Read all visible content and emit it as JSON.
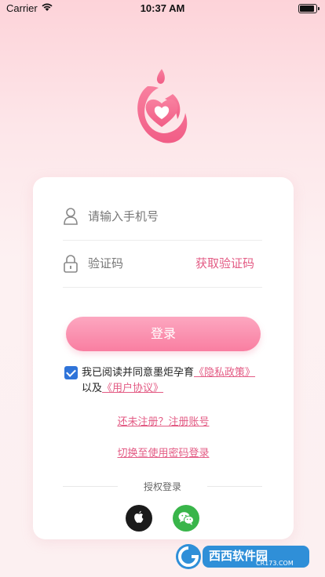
{
  "status_bar": {
    "carrier": "Carrier",
    "time": "10:37 AM"
  },
  "login_form": {
    "phone_placeholder": "请输入手机号",
    "code_placeholder": "验证码",
    "get_code_label": "获取验证码",
    "login_button": "登录"
  },
  "agreement": {
    "checked": true,
    "prefix": "我已阅读并同意墨炬孕育",
    "privacy_link": "《隐私政策》",
    "connector": "以及",
    "terms_link": "《用户协议》"
  },
  "links": {
    "register": "还未注册？注册账号",
    "password_login": "切换至使用密码登录"
  },
  "auth": {
    "label": "授权登录",
    "apple_icon": "apple-icon",
    "wechat_icon": "wechat-icon"
  },
  "watermark": {
    "brand": "西西软件园",
    "domain": "CR173.COM"
  },
  "colors": {
    "accent": "#e35b84",
    "button": "#f97ea1",
    "checkbox": "#2f74d9",
    "wechat": "#39b54a"
  }
}
